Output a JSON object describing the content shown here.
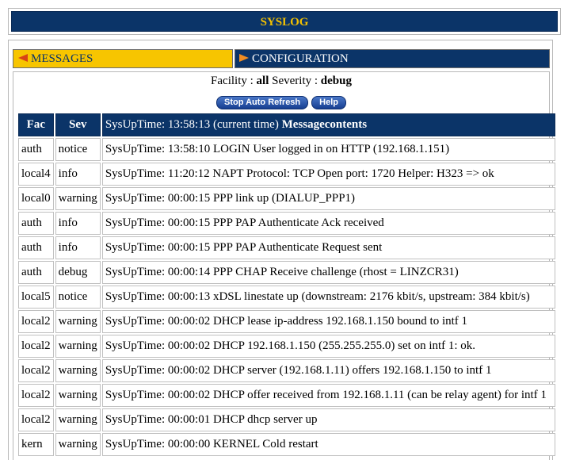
{
  "header": {
    "title": "SYSLOG"
  },
  "tabs": [
    {
      "label": "MESSAGES",
      "active": true
    },
    {
      "label": "CONFIGURATION",
      "active": false
    }
  ],
  "filter": {
    "facility_label": "Facility :",
    "facility_value": "all",
    "severity_label": "Severity :",
    "severity_value": "debug"
  },
  "buttons": {
    "stop_refresh": "Stop Auto Refresh",
    "help": "Help"
  },
  "table": {
    "headers": {
      "fac": "Fac",
      "sev": "Sev",
      "msg_prefix": "SysUpTime: 13:58:13 (current time)",
      "msg_bold": "Messagecontents"
    },
    "rows": [
      {
        "fac": "auth",
        "sev": "notice",
        "msg": "SysUpTime: 13:58:10 LOGIN User logged in on HTTP (192.168.1.151)"
      },
      {
        "fac": "local4",
        "sev": "info",
        "msg": "SysUpTime: 11:20:12 NAPT Protocol: TCP Open port: 1720 Helper: H323 => ok"
      },
      {
        "fac": "local0",
        "sev": "warning",
        "msg": "SysUpTime: 00:00:15 PPP link up (DIALUP_PPP1)"
      },
      {
        "fac": "auth",
        "sev": "info",
        "msg": "SysUpTime: 00:00:15 PPP PAP Authenticate Ack received"
      },
      {
        "fac": "auth",
        "sev": "info",
        "msg": "SysUpTime: 00:00:15 PPP PAP Authenticate Request sent"
      },
      {
        "fac": "auth",
        "sev": "debug",
        "msg": "SysUpTime: 00:00:14 PPP CHAP Receive challenge (rhost = LINZCR31)"
      },
      {
        "fac": "local5",
        "sev": "notice",
        "msg": "SysUpTime: 00:00:13 xDSL linestate up (downstream: 2176 kbit/s, upstream: 384 kbit/s)"
      },
      {
        "fac": "local2",
        "sev": "warning",
        "msg": "SysUpTime: 00:00:02 DHCP lease ip-address 192.168.1.150 bound to intf 1"
      },
      {
        "fac": "local2",
        "sev": "warning",
        "msg": "SysUpTime: 00:00:02 DHCP 192.168.1.150 (255.255.255.0) set on intf 1: ok."
      },
      {
        "fac": "local2",
        "sev": "warning",
        "msg": "SysUpTime: 00:00:02 DHCP server (192.168.1.11) offers 192.168.1.150 to intf 1"
      },
      {
        "fac": "local2",
        "sev": "warning",
        "msg": "SysUpTime: 00:00:02 DHCP offer received from 192.168.1.11 (can be relay agent) for intf 1"
      },
      {
        "fac": "local2",
        "sev": "warning",
        "msg": "SysUpTime: 00:00:01 DHCP dhcp server up"
      },
      {
        "fac": "kern",
        "sev": "warning",
        "msg": "SysUpTime: 00:00:00 KERNEL Cold restart"
      }
    ]
  },
  "icons": {
    "active_tab_arrow": "arrow-left-icon",
    "inactive_tab_arrow": "arrow-right-icon"
  },
  "colors": {
    "navy": "#0b3468",
    "gold": "#f7c500",
    "title_text": "#f3c100"
  }
}
